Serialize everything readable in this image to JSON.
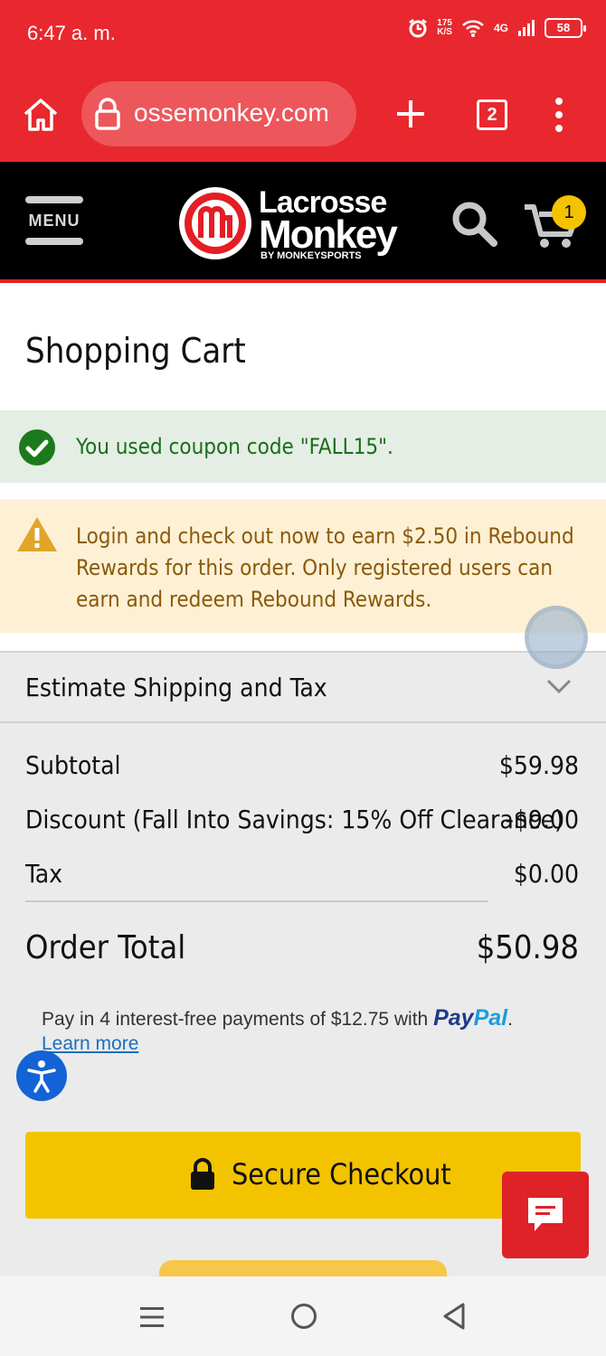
{
  "status_bar": {
    "time": "6:47 a. m.",
    "net_speed_value": "175",
    "net_speed_unit": "K/S",
    "network": "4G",
    "battery": "58"
  },
  "browser": {
    "url": "ossemonkey.com",
    "tab_count": "2"
  },
  "site_header": {
    "menu_label": "MENU",
    "logo_line1": "Lacrosse",
    "logo_line2": "Monkey",
    "logo_sub": "BY MONKEYSPORTS",
    "cart_count": "1"
  },
  "page": {
    "title": "Shopping Cart"
  },
  "messages": {
    "coupon": "You used coupon code \"FALL15\".",
    "rewards": "Login and check out now to earn $2.50 in Rebound Rewards for this order. Only registered users can earn and redeem Rebound Rewards."
  },
  "estimate": {
    "label": "Estimate Shipping and Tax"
  },
  "summary": {
    "subtotal_label": "Subtotal",
    "subtotal_value": "$59.98",
    "discount_label": "Discount (Fall Into Savings: 15% Off Clearance)",
    "discount_value": "-$9.00",
    "tax_label": "Tax",
    "tax_value": "$0.00",
    "total_label": "Order Total",
    "total_value": "$50.98",
    "paypal_text": "Pay in 4 interest-free payments of $12.75 with",
    "paypal_logo_a": "Pay",
    "paypal_logo_b": "Pal",
    "paypal_period": ".",
    "learn_more": "Learn more",
    "checkout_label": "Secure Checkout"
  },
  "colors": {
    "brand_red": "#e8282e",
    "checkout_yellow": "#f3c300",
    "success_green": "#1a6e1a",
    "warning_amber": "#8a5a0a",
    "accessibility_blue": "#1463d6"
  }
}
